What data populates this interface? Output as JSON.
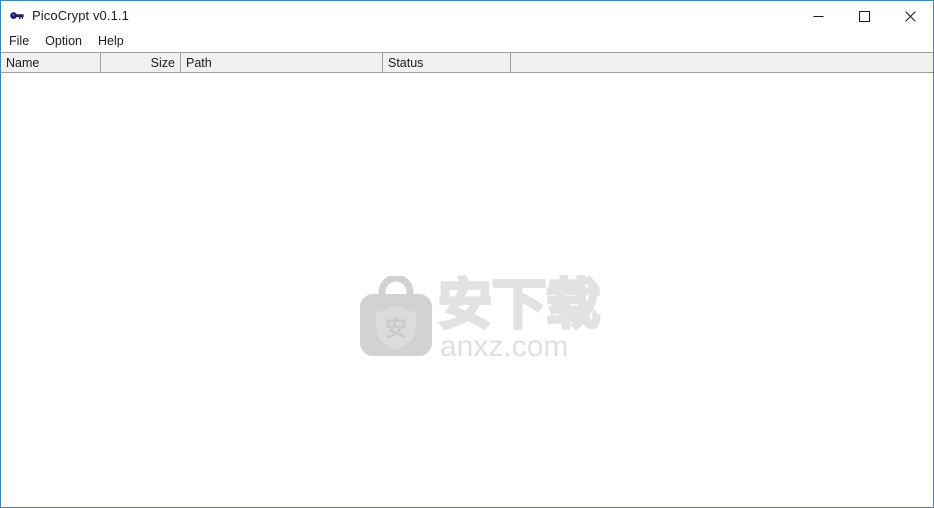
{
  "window": {
    "title": "PicoCrypt v0.1.1",
    "icon": "key-icon",
    "border_color": "#3d88b0",
    "background": "#ffffff",
    "controls": {
      "minimize_label": "Minimize",
      "maximize_label": "Maximize",
      "close_label": "Close"
    }
  },
  "menu": {
    "items": [
      {
        "label": "File"
      },
      {
        "label": "Option"
      },
      {
        "label": "Help"
      }
    ]
  },
  "file_list": {
    "columns": [
      {
        "label": "Name",
        "align": "left"
      },
      {
        "label": "Size",
        "align": "right"
      },
      {
        "label": "Path",
        "align": "left"
      },
      {
        "label": "Status",
        "align": "left"
      },
      {
        "label": "",
        "align": "left"
      }
    ],
    "rows": [],
    "header_background": "#f0f0f0",
    "body_background": "#ffffff"
  },
  "watermark": {
    "chinese_text": "安下载",
    "domain_text": "anxz.com",
    "shield_char": "安",
    "color": "#e2e2e2",
    "bag_icon": "briefcase-shield-icon"
  }
}
